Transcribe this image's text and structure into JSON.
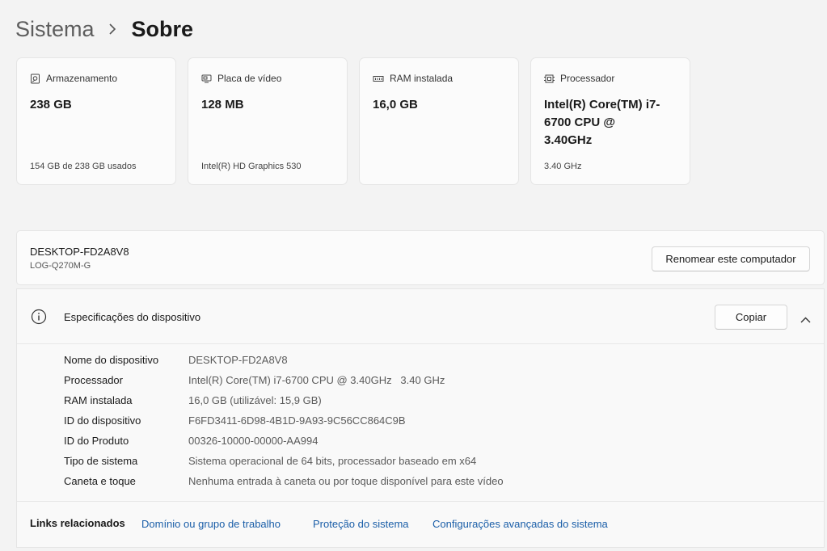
{
  "breadcrumb": {
    "parent": "Sistema",
    "current": "Sobre"
  },
  "cards": [
    {
      "icon": "storage-icon",
      "title": "Armazenamento",
      "value": "238 GB",
      "sub": "154 GB de 238 GB usados"
    },
    {
      "icon": "display-adapter-icon",
      "title": "Placa de vídeo",
      "value": "128 MB",
      "sub": "Intel(R) HD Graphics 530"
    },
    {
      "icon": "ram-icon",
      "title": "RAM instalada",
      "value": "16,0 GB",
      "sub": ""
    },
    {
      "icon": "processor-icon",
      "title": "Processador",
      "value": "Intel(R) Core(TM) i7-6700 CPU @ 3.40GHz",
      "sub": "3.40 GHz"
    }
  ],
  "device": {
    "name": "DESKTOP-FD2A8V8",
    "model": "LOG-Q270M-G",
    "rename_label": "Renomear este computador"
  },
  "specs": {
    "title": "Especificações do dispositivo",
    "copy_label": "Copiar",
    "rows": [
      {
        "label": "Nome do dispositivo",
        "value": "DESKTOP-FD2A8V8"
      },
      {
        "label": "Processador",
        "value": "Intel(R) Core(TM) i7-6700 CPU @ 3.40GHz   3.40 GHz"
      },
      {
        "label": "RAM instalada",
        "value": "16,0 GB (utilizável: 15,9 GB)"
      },
      {
        "label": "ID do dispositivo",
        "value": "F6FD3411-6D98-4B1D-9A93-9C56CC864C9B"
      },
      {
        "label": "ID do Produto",
        "value": "00326-10000-00000-AA994"
      },
      {
        "label": "Tipo de sistema",
        "value": "Sistema operacional de 64 bits, processador baseado em x64"
      },
      {
        "label": "Caneta e toque",
        "value": "Nenhuma entrada à caneta ou por toque disponível para este vídeo"
      }
    ]
  },
  "related": {
    "label": "Links relacionados",
    "links": [
      "Domínio ou grupo de trabalho",
      "Proteção do sistema",
      "Configurações avançadas do sistema"
    ]
  },
  "colors": {
    "link": "#1a5ea8",
    "background": "#f3f3f3",
    "card": "#fbfbfb"
  }
}
